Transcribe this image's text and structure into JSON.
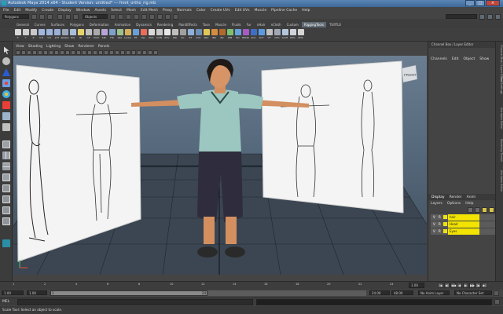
{
  "window": {
    "title": "Autodesk Maya 2014 x64 - Student Version: untitled* --- front_ortho_rig.mb",
    "buttons": [
      "_",
      "□",
      "×"
    ]
  },
  "menubar": {
    "items": [
      "File",
      "Edit",
      "Modify",
      "Create",
      "Display",
      "Window",
      "Assets",
      "Select",
      "Mesh",
      "Edit Mesh",
      "Proxy",
      "Normals",
      "Color",
      "Create UVs",
      "Edit UVs",
      "Muscle",
      "Pipeline Cache",
      "Help"
    ]
  },
  "statusline": {
    "mode": "Polygons",
    "objects_label": "Objects"
  },
  "shelf_tabs": {
    "tabs": [
      "General",
      "Curves",
      "Surfaces",
      "Polygons",
      "Deformation",
      "Animation",
      "Dynamics",
      "Rendering",
      "PaintEffects",
      "Toon",
      "Muscle",
      "Fluids",
      "Fur",
      "nHair",
      "nCloth",
      "Custom",
      "RiggingTools",
      "TURTLE"
    ],
    "active_index": 16
  },
  "shelf": {
    "buttons": [
      {
        "label": "X",
        "color": "#d9d9d9"
      },
      {
        "label": "Y",
        "color": "#cfcfcf"
      },
      {
        "label": "Z",
        "color": "#c8c8c8"
      },
      {
        "label": "X-H",
        "color": "#a0b8e0"
      },
      {
        "label": "Y-H",
        "color": "#9fb4da"
      },
      {
        "label": "Z-H",
        "color": "#9ab0d6"
      },
      {
        "label": "Rotate",
        "color": "#9aa6b8"
      },
      {
        "label": "RVJ",
        "color": "#a9bfd9"
      },
      {
        "label": "IK",
        "color": "#e7d36b"
      },
      {
        "label": "CP",
        "color": "#c0c0c0"
      },
      {
        "label": "PCN",
        "color": "#a9a9a9"
      },
      {
        "label": "SPL",
        "color": "#b9a5d4"
      },
      {
        "label": "FIK",
        "color": "#7fa0c8"
      },
      {
        "label": "LRA",
        "color": "#9cc08e"
      },
      {
        "label": "LockA",
        "color": "#d4b05e"
      },
      {
        "label": "FP",
        "color": "#6aa0d8"
      },
      {
        "label": "Par",
        "color": "#e86d5c"
      },
      {
        "label": "POC",
        "color": "#d8d8d8"
      },
      {
        "label": "CON",
        "color": "#c9c9c9"
      },
      {
        "label": "PCV",
        "color": "#e8e8e8"
      },
      {
        "label": "ORI",
        "color": "#bfbfbf"
      },
      {
        "label": "SC",
        "color": "#a0a0a0"
      },
      {
        "label": "PT",
        "color": "#8fb0d6"
      },
      {
        "label": "COL",
        "color": "#6f8fb5"
      },
      {
        "label": "SRC",
        "color": "#e0c75a"
      },
      {
        "label": "BN",
        "color": "#d48c42"
      },
      {
        "label": "BV",
        "color": "#b06a30"
      },
      {
        "label": "WM",
        "color": "#7fbf6f"
      },
      {
        "label": "SD",
        "color": "#66a3d9"
      },
      {
        "label": "BKDN",
        "color": "#a45cc0"
      },
      {
        "label": "SCC",
        "color": "#3f6fc4"
      },
      {
        "label": "SCT",
        "color": "#5a9be0"
      },
      {
        "label": "VT",
        "color": "#c0c0c0"
      },
      {
        "label": "CFG",
        "color": "#9fa9b6"
      },
      {
        "label": "AddT",
        "color": "#b5c6da"
      },
      {
        "label": "RFG",
        "color": "#cfd4da"
      },
      {
        "label": "PHS",
        "color": "#d6d6d6"
      }
    ]
  },
  "viewport": {
    "menu": [
      "View",
      "Shading",
      "Lighting",
      "Show",
      "Renderer",
      "Panels"
    ],
    "view_cube": "FRONT",
    "axis_label": "y"
  },
  "channelbox": {
    "header": "Channel Box / Layer Editor",
    "menu": [
      "Channels",
      "Edit",
      "Object",
      "Show"
    ]
  },
  "side_tabs": [
    "Channel Box / Layer Editor",
    "Tool Settings",
    "Attribute Editor",
    "Modeling Toolkit",
    "Attribute Editor"
  ],
  "layer_editor": {
    "tabs": [
      "Display",
      "Render",
      "Anim"
    ],
    "menu": [
      "Layers",
      "Options",
      "Help"
    ],
    "layers": [
      {
        "v": "V",
        "p": "",
        "r": "R",
        "name": "hair"
      },
      {
        "v": "V",
        "p": "",
        "r": "R",
        "name": "Head"
      },
      {
        "v": "V",
        "p": "",
        "r": "R",
        "name": "Eyes"
      }
    ]
  },
  "timeslider": {
    "ticks": [
      "1",
      "2",
      "4",
      "6",
      "8",
      "10",
      "12",
      "14",
      "16",
      "18",
      "20",
      "22",
      "24"
    ],
    "current_frame": "1.00",
    "playback_buttons": [
      "|◀",
      "◀|",
      "◀◀",
      "◀",
      "▶",
      "▶▶",
      "|▶",
      "▶|"
    ]
  },
  "range": {
    "start_field": "1.00",
    "inner_start": "1.00",
    "slider_start": "1",
    "slider_end": "24",
    "end_field": "24.00",
    "outer_end": "48.00",
    "anim_layer": "No Anim Layer",
    "char_set": "No Character Set"
  },
  "mel": {
    "label": "MEL"
  },
  "help_line": "Scale Tool: Select an object to scale."
}
